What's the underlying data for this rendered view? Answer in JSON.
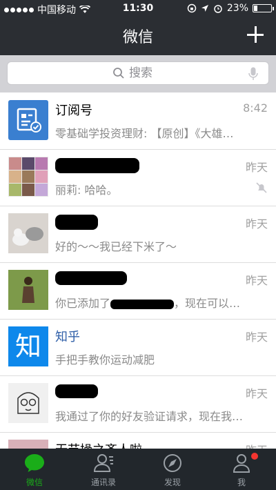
{
  "status_bar": {
    "carrier": "中国移动",
    "time": "11:30",
    "battery": "23%",
    "battery_level": 0.23
  },
  "nav": {
    "title": "微信"
  },
  "search": {
    "placeholder": "搜索"
  },
  "chats": [
    {
      "name": "订阅号",
      "time": "8:42",
      "preview": "零基础学投资理财: 【原创】《大雄…"
    },
    {
      "name": "",
      "time": "昨天",
      "preview": "丽莉: 哈哈。",
      "muted": true
    },
    {
      "name": "",
      "time": "昨天",
      "preview": "好的～～我已经下米了～"
    },
    {
      "name": "",
      "time": "昨天",
      "preview": "你已添加了",
      "preview_tail": "，现在可以…"
    },
    {
      "name": "知乎",
      "time": "昨天",
      "preview": "手把手教你运动减肥"
    },
    {
      "name": "",
      "time": "昨天",
      "preview": "我通过了你的好友验证请求，现在我…"
    },
    {
      "name": "无节操之齐人啦",
      "time": "昨天",
      "preview": ""
    }
  ],
  "tabs": [
    {
      "label": "微信",
      "icon": "chat-bubble-icon",
      "active": true
    },
    {
      "label": "通讯录",
      "icon": "contacts-icon"
    },
    {
      "label": "发现",
      "icon": "compass-icon"
    },
    {
      "label": "我",
      "icon": "person-icon",
      "badge": true
    }
  ],
  "colors": {
    "header_bg": "#2b2e33",
    "tab_bar_bg": "#22272c",
    "active_tab": "#1aad19",
    "official_name": "#2f5fa8",
    "badge": "#f43530"
  }
}
